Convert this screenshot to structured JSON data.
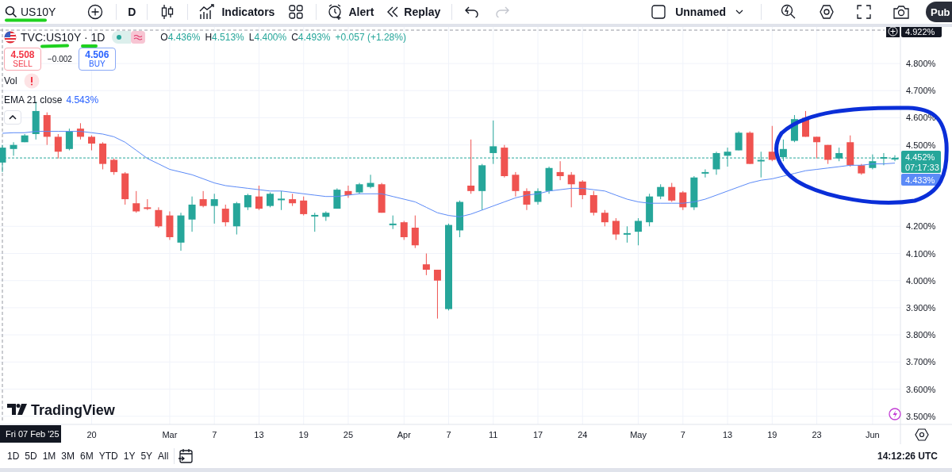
{
  "toolbar": {
    "items": [
      {
        "kind": "symbol",
        "label": "US10Y"
      },
      {
        "kind": "add"
      },
      {
        "kind": "interval",
        "label": "D"
      },
      {
        "kind": "chart-type"
      },
      {
        "kind": "indicators",
        "label": "Indicators"
      },
      {
        "kind": "templates"
      },
      {
        "kind": "alert",
        "label": "Alert"
      },
      {
        "kind": "replay",
        "label": "Replay"
      },
      {
        "kind": "undo",
        "disabled": false
      },
      {
        "kind": "redo",
        "disabled": true
      }
    ],
    "layout_name": "Unnamed",
    "publish_label": "Pub"
  },
  "legend": {
    "symbol": "TVC:US10Y · 1D",
    "ohlc": [
      {
        "label": "O",
        "value": "4.436%"
      },
      {
        "label": "H",
        "value": "4.513%"
      },
      {
        "label": "L",
        "value": "4.400%"
      },
      {
        "label": "C",
        "value": "4.493%"
      }
    ],
    "change": "+0.057 (+1.28%)",
    "sell": {
      "price": "4.508",
      "label": "SELL"
    },
    "spread": "−0.002",
    "buy": {
      "price": "4.506",
      "label": "BUY"
    },
    "indicators": [
      {
        "kind": "warning",
        "name": "Vol"
      },
      {
        "kind": "series",
        "value": "4.543%"
      }
    ]
  },
  "chart": {
    "crosshair_price": "4.922%",
    "crosshair_date": "Fri 07 Feb '25",
    "last_price": "4.452%",
    "countdown": "07:17:33",
    "ema_price": "4.433%",
    "watermark_logo": "TradingView",
    "chart_data": {
      "type": "candlestick",
      "grid": true,
      "ylim": [
        3.47,
        4.923
      ],
      "categories": [
        null,
        null,
        null,
        null,
        null,
        null,
        null,
        null,
        "20",
        null,
        null,
        null,
        null,
        null,
        null,
        "Mar",
        null,
        null,
        null,
        "7",
        null,
        null,
        null,
        "13",
        null,
        null,
        null,
        "19",
        null,
        null,
        null,
        "25",
        null,
        null,
        null,
        null,
        "Apr",
        null,
        null,
        null,
        "7",
        null,
        null,
        null,
        "11",
        null,
        null,
        null,
        "17",
        null,
        null,
        null,
        "24",
        null,
        null,
        null,
        null,
        "May",
        null,
        null,
        null,
        "7",
        null,
        null,
        null,
        "13",
        null,
        null,
        null,
        "19",
        null,
        null,
        null,
        "23",
        null,
        null,
        null,
        null,
        "Jun",
        null,
        null
      ],
      "yticks": [
        {
          "value": 4.8,
          "label": "4.800%"
        },
        {
          "value": 4.7,
          "label": "4.700%"
        },
        {
          "value": 4.6,
          "label": "4.600%"
        },
        {
          "value": 4.5,
          "label": "4.500%"
        },
        {
          "value": 4.2,
          "label": "4.200%"
        },
        {
          "value": 4.1,
          "label": "4.100%"
        },
        {
          "value": 4.0,
          "label": "4.000%"
        },
        {
          "value": 3.9,
          "label": "3.900%"
        },
        {
          "value": 3.8,
          "label": "3.800%"
        },
        {
          "value": 3.7,
          "label": "3.700%"
        },
        {
          "value": 3.6,
          "label": "3.600%"
        },
        {
          "value": 3.5,
          "label": "3.500%"
        }
      ],
      "ohlc": [
        [
          4.435,
          4.5,
          4.4,
          4.49
        ],
        [
          4.485,
          4.51,
          4.46,
          4.5
        ],
        [
          4.51,
          4.54,
          4.51,
          4.535
        ],
        [
          4.54,
          4.66,
          4.52,
          4.625
        ],
        [
          4.61,
          4.62,
          4.5,
          4.53
        ],
        [
          4.53,
          4.54,
          4.45,
          4.475
        ],
        [
          4.485,
          4.56,
          4.48,
          4.55
        ],
        [
          4.56,
          4.58,
          4.52,
          4.53
        ],
        [
          4.53,
          4.535,
          4.48,
          4.505
        ],
        [
          4.505,
          4.51,
          4.41,
          4.43
        ],
        [
          4.445,
          4.45,
          4.39,
          4.4
        ],
        [
          4.395,
          4.4,
          4.28,
          4.3
        ],
        [
          4.285,
          4.33,
          4.25,
          4.255
        ],
        [
          4.27,
          4.3,
          4.26,
          4.265
        ],
        [
          4.26,
          4.27,
          4.195,
          4.2
        ],
        [
          4.24,
          4.255,
          4.15,
          4.16
        ],
        [
          4.14,
          4.25,
          4.11,
          4.24
        ],
        [
          4.225,
          4.31,
          4.18,
          4.28
        ],
        [
          4.3,
          4.33,
          4.27,
          4.275
        ],
        [
          4.275,
          4.32,
          4.21,
          4.3
        ],
        [
          4.265,
          4.28,
          4.2,
          4.215
        ],
        [
          4.2,
          4.29,
          4.17,
          4.285
        ],
        [
          4.27,
          4.32,
          4.26,
          4.315
        ],
        [
          4.31,
          4.35,
          4.26,
          4.265
        ],
        [
          4.275,
          4.325,
          4.27,
          4.32
        ],
        [
          4.3,
          4.33,
          4.26,
          4.302
        ],
        [
          4.3,
          4.32,
          4.275,
          4.285
        ],
        [
          4.295,
          4.31,
          4.24,
          4.245
        ],
        [
          4.24,
          4.25,
          4.18,
          4.242
        ],
        [
          4.235,
          4.255,
          4.22,
          4.25
        ],
        [
          4.265,
          4.34,
          4.265,
          4.335
        ],
        [
          4.33,
          4.35,
          4.305,
          4.315
        ],
        [
          4.325,
          4.36,
          4.32,
          4.355
        ],
        [
          4.345,
          4.39,
          4.34,
          4.36
        ],
        [
          4.355,
          4.36,
          4.25,
          4.25
        ],
        [
          4.205,
          4.24,
          4.19,
          4.21
        ],
        [
          4.215,
          4.22,
          4.15,
          4.16
        ],
        [
          4.195,
          4.24,
          4.12,
          4.13
        ],
        [
          4.06,
          4.1,
          4.02,
          4.04
        ],
        [
          4.04,
          4.04,
          3.86,
          4.0
        ],
        [
          3.895,
          4.21,
          3.89,
          4.205
        ],
        [
          4.185,
          4.295,
          4.16,
          4.29
        ],
        [
          4.35,
          4.52,
          4.32,
          4.33
        ],
        [
          4.33,
          4.43,
          4.26,
          4.425
        ],
        [
          4.47,
          4.59,
          4.43,
          4.495
        ],
        [
          4.49,
          4.5,
          4.38,
          4.385
        ],
        [
          4.39,
          4.4,
          4.31,
          4.33
        ],
        [
          4.33,
          4.34,
          4.26,
          4.28
        ],
        [
          4.29,
          4.34,
          4.28,
          4.33
        ],
        [
          4.33,
          4.42,
          4.32,
          4.415
        ],
        [
          4.4,
          4.44,
          4.37,
          4.385
        ],
        [
          4.39,
          4.4,
          4.27,
          4.355
        ],
        [
          4.365,
          4.37,
          4.3,
          4.315
        ],
        [
          4.315,
          4.33,
          4.24,
          4.25
        ],
        [
          4.25,
          4.26,
          4.2,
          4.215
        ],
        [
          4.22,
          4.23,
          4.15,
          4.17
        ],
        [
          4.17,
          4.2,
          4.14,
          4.175
        ],
        [
          4.18,
          4.23,
          4.13,
          4.22
        ],
        [
          4.215,
          4.32,
          4.2,
          4.31
        ],
        [
          4.31,
          4.355,
          4.3,
          4.345
        ],
        [
          4.345,
          4.36,
          4.29,
          4.295
        ],
        [
          4.325,
          4.33,
          4.26,
          4.27
        ],
        [
          4.27,
          4.385,
          4.26,
          4.38
        ],
        [
          4.395,
          4.41,
          4.38,
          4.4
        ],
        [
          4.41,
          4.475,
          4.39,
          4.47
        ],
        [
          4.46,
          4.49,
          4.42,
          4.475
        ],
        [
          4.48,
          4.55,
          4.48,
          4.545
        ],
        [
          4.545,
          4.55,
          4.43,
          4.43
        ],
        [
          4.44,
          4.475,
          4.38,
          4.445
        ],
        [
          4.475,
          4.57,
          4.44,
          4.445
        ],
        [
          4.455,
          4.52,
          4.44,
          4.485
        ],
        [
          4.515,
          4.61,
          4.51,
          4.595
        ],
        [
          4.6,
          4.625,
          4.53,
          4.53
        ],
        [
          4.53,
          4.53,
          4.45,
          4.51
        ],
        [
          4.5,
          4.5,
          4.43,
          4.445
        ],
        [
          4.45,
          4.49,
          4.44,
          4.47
        ],
        [
          4.51,
          4.535,
          4.42,
          4.425
        ],
        [
          4.425,
          4.43,
          4.39,
          4.395
        ],
        [
          4.415,
          4.465,
          4.41,
          4.44
        ],
        [
          4.45,
          4.47,
          4.425,
          4.455
        ],
        [
          4.45,
          4.462,
          4.44,
          4.452
        ]
      ],
      "series": [
        {
          "name": "EMA 21 close",
          "type": "line",
          "color": "#5b8af7",
          "values": [
            4.543,
            4.545,
            4.545,
            4.55,
            4.55,
            4.55,
            4.55,
            4.55,
            4.545,
            4.54,
            4.53,
            4.51,
            4.48,
            4.45,
            4.43,
            4.41,
            4.4,
            4.39,
            4.375,
            4.36,
            4.35,
            4.345,
            4.34,
            4.335,
            4.33,
            4.33,
            4.325,
            4.32,
            4.315,
            4.31,
            4.31,
            4.315,
            4.32,
            4.32,
            4.32,
            4.31,
            4.3,
            4.29,
            4.27,
            4.25,
            4.24,
            4.235,
            4.245,
            4.26,
            4.275,
            4.29,
            4.305,
            4.315,
            4.32,
            4.33,
            4.335,
            4.34,
            4.34,
            4.335,
            4.33,
            4.315,
            4.3,
            4.29,
            4.285,
            4.285,
            4.285,
            4.285,
            4.29,
            4.3,
            4.315,
            4.33,
            4.345,
            4.36,
            4.37,
            4.375,
            4.385,
            4.395,
            4.405,
            4.41,
            4.415,
            4.42,
            4.425,
            4.425,
            4.43,
            4.43,
            4.433
          ]
        }
      ],
      "ref_lines": [
        {
          "axis": "y",
          "value": 4.452,
          "color": "#26a69a"
        }
      ]
    }
  },
  "bottom_bar": {
    "ranges": [
      "1D",
      "5D",
      "1M",
      "3M",
      "6M",
      "YTD",
      "1Y",
      "5Y",
      "All"
    ],
    "clock": "14:12:26 UTC"
  }
}
